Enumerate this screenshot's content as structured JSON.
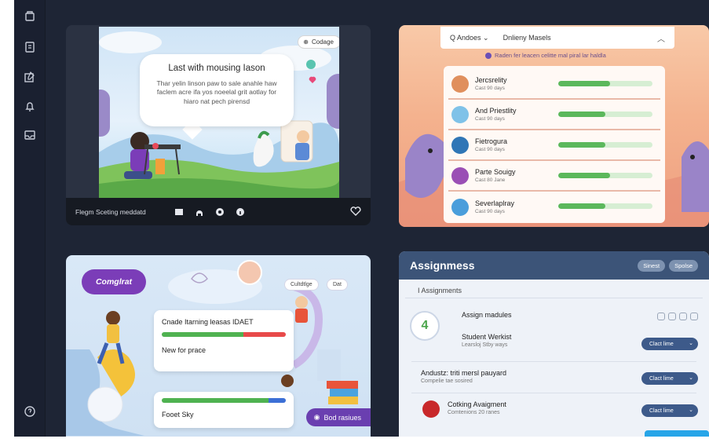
{
  "sidebar": {
    "icons": [
      "home-icon",
      "book-icon",
      "edit-icon",
      "bell-icon",
      "inbox-icon",
      "help-icon"
    ]
  },
  "video_card": {
    "cc_label": "Codage",
    "bubble_title": "Last with mousing Iason",
    "bubble_body": "Thar yelin linson paw to sale anahle haw faclem acre ifa yos noeelal grit aotlay for hiaro nat pech pirensd",
    "control_label": "Flegm Sceting meddatd"
  },
  "leaderboard": {
    "dropdown_label": "Q Andoes",
    "dropdown_title": "Dnlieny Masels",
    "hint": "Raden fer leacen celitte mal piral lar haldla",
    "rows": [
      {
        "name": "Jercsrelity",
        "sub": "Cast 90 days",
        "progress": 0.55,
        "color": "#e08f5d"
      },
      {
        "name": "And Priestlity",
        "sub": "Cast 90 days",
        "progress": 0.5,
        "color": "#7fc2e8"
      },
      {
        "name": "Fietrogura",
        "sub": "Cast 90 days",
        "progress": 0.5,
        "color": "#2f76b6"
      },
      {
        "name": "Parte Souigy",
        "sub": "Cast 80 Jane",
        "progress": 0.55,
        "color": "#9a4fb5"
      },
      {
        "name": "Severlaplray",
        "sub": "Cast 90 days",
        "progress": 0.5,
        "color": "#4a9edb"
      }
    ]
  },
  "completed_card": {
    "badge": "Comglrat",
    "chip_a": "Cultdtlge",
    "chip_b": "Dat",
    "question_title": "Cnade Itarning leasas IDAET",
    "question_sub": "New for prace",
    "final_title": "Fooet Sky",
    "final_badge": "Bod rasiues"
  },
  "assignments": {
    "title": "Assignmess",
    "pill_a": "Sinest",
    "pill_b": "Spolse",
    "subheader": "I Assignments",
    "count": "4",
    "assign_modules": "Assign madules",
    "student_works": "Student Werkist",
    "student_sub": "Learsloj Stby ways",
    "row2_title": "Andustz: triti mersl pauyard",
    "row2_sub": "Compelie tae sosired",
    "row3_title": "Cotking Avaigment",
    "row3_sub": "Comtenions 20 ranes",
    "button_label": "Clact lime"
  }
}
